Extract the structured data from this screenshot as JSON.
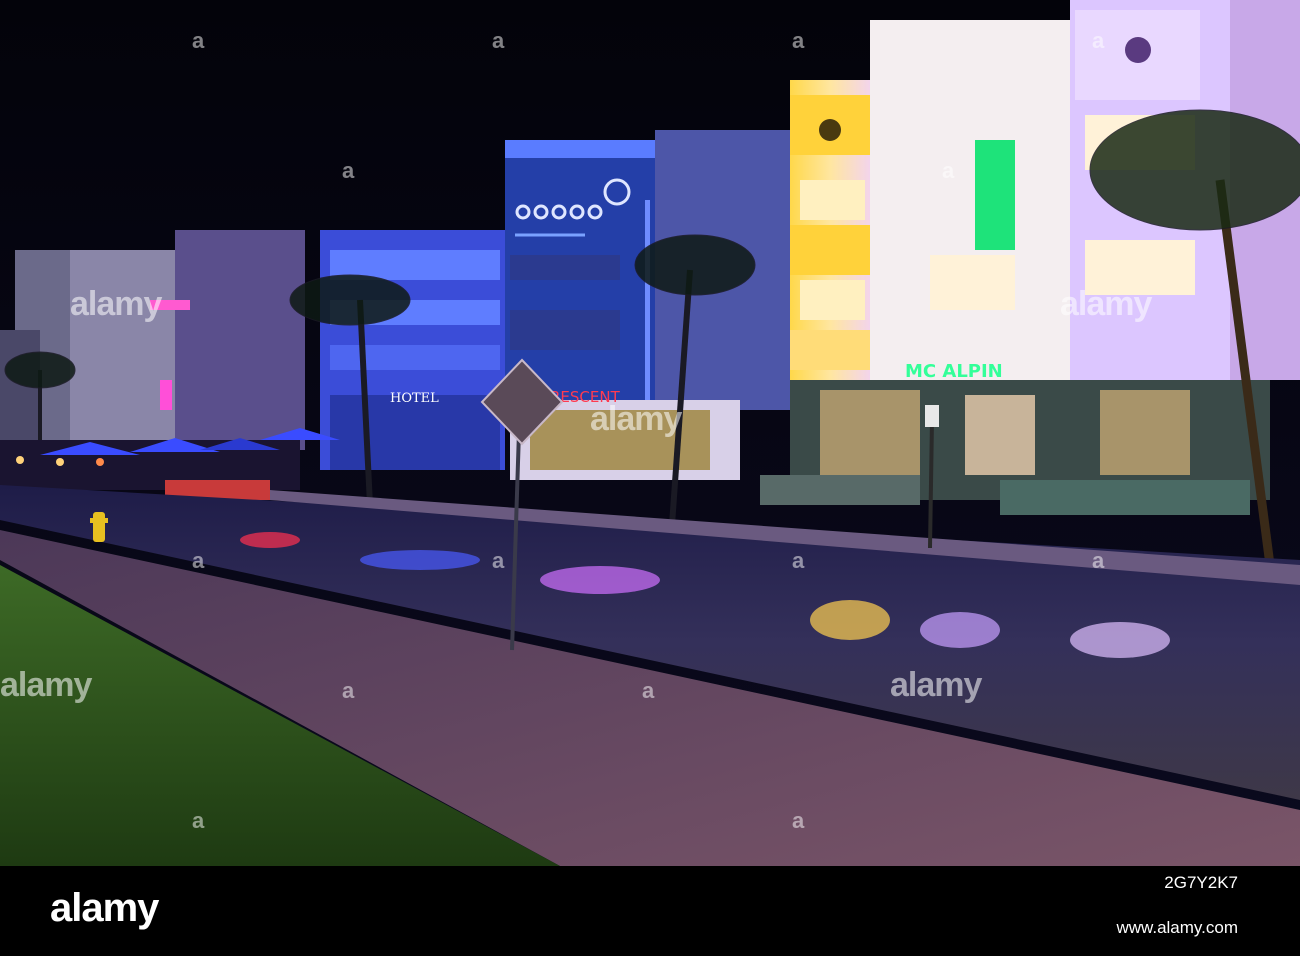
{
  "photo": {
    "signs": {
      "hotel_sign": "HOTEL",
      "crescent_sign": "RESCENT",
      "mcalpin_sign": "MC ALPIN"
    },
    "colors": {
      "sky": "#05040e",
      "neon_blue": "#2a4bff",
      "neon_purple": "#c36bff",
      "neon_yellow": "#ffd23a",
      "neon_green": "#1ee37a",
      "neon_red": "#ff3040",
      "grass": "#2f5a1e",
      "sidewalk": "#6b4a66",
      "road": "#2d2a44"
    }
  },
  "watermark": {
    "text": "alamy"
  },
  "footer": {
    "logo": "alamy",
    "image_id": "2G7Y2K7",
    "url": "www.alamy.com"
  }
}
